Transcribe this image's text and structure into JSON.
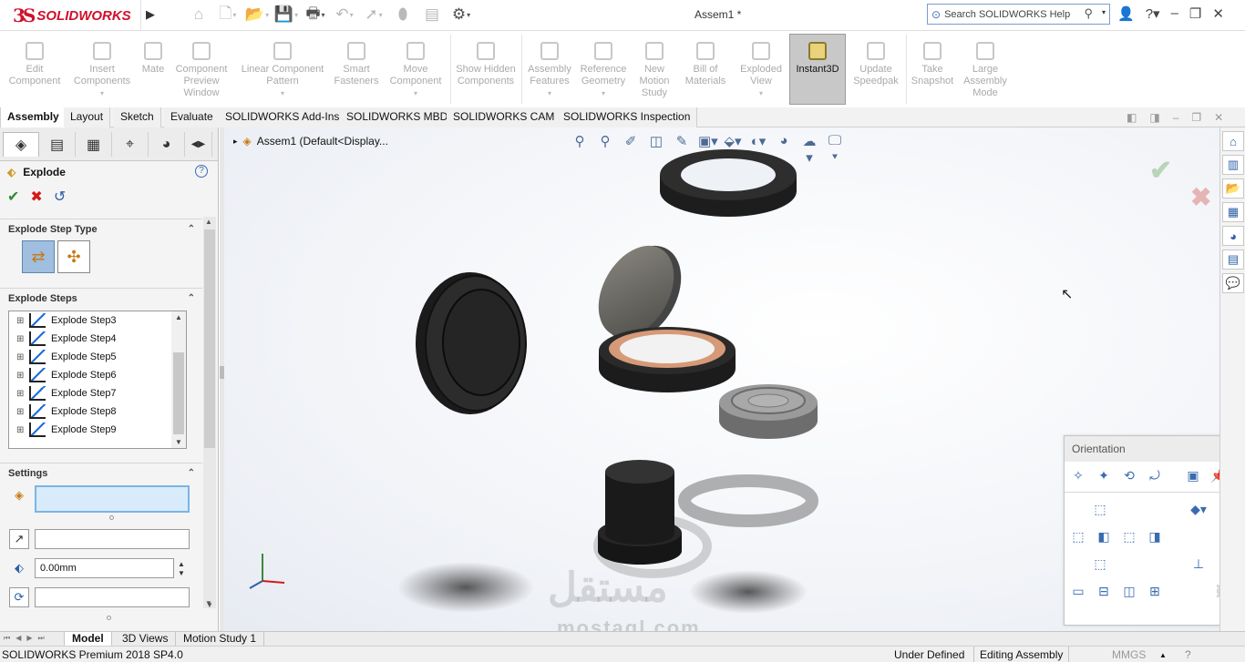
{
  "app": {
    "logo_mark": "3S",
    "logo_text": "SOLIDWORKS",
    "window_title": "Assem1 *"
  },
  "search": {
    "placeholder": "Search SOLIDWORKS Help"
  },
  "ribbon": {
    "buttons": [
      {
        "label": "Edit Component",
        "icon": "edit-component-icon"
      },
      {
        "label": "Insert Components",
        "icon": "insert-components-icon"
      },
      {
        "label": "Mate",
        "icon": "mate-icon"
      },
      {
        "label": "Component Preview Window",
        "icon": "preview-window-icon"
      },
      {
        "label": "Linear Component Pattern",
        "icon": "linear-pattern-icon"
      },
      {
        "label": "Smart Fasteners",
        "icon": "smart-fasteners-icon"
      },
      {
        "label": "Move Component",
        "icon": "move-component-icon"
      },
      {
        "label": "Show Hidden Components",
        "icon": "show-hidden-icon"
      },
      {
        "label": "Assembly Features",
        "icon": "assembly-features-icon"
      },
      {
        "label": "Reference Geometry",
        "icon": "reference-geometry-icon"
      },
      {
        "label": "New Motion Study",
        "icon": "motion-study-icon"
      },
      {
        "label": "Bill of Materials",
        "icon": "bom-icon"
      },
      {
        "label": "Exploded View",
        "icon": "exploded-view-icon"
      },
      {
        "label": "Instant3D",
        "icon": "instant3d-icon"
      },
      {
        "label": "Update Speedpak",
        "icon": "speedpak-icon"
      },
      {
        "label": "Take Snapshot",
        "icon": "snapshot-icon"
      },
      {
        "label": "Large Assembly Mode",
        "icon": "large-assembly-icon"
      }
    ]
  },
  "command_tabs": [
    "Assembly",
    "Layout",
    "Sketch",
    "Evaluate",
    "SOLIDWORKS Add-Ins",
    "SOLIDWORKS MBD",
    "SOLIDWORKS CAM",
    "SOLIDWORKS Inspection"
  ],
  "feature_manager": {
    "crumb": "Assem1  (Default<Display..."
  },
  "property_manager": {
    "title": "Explode",
    "help": "?",
    "section_step_type": "Explode Step Type",
    "section_steps": "Explode Steps",
    "section_settings": "Settings",
    "steps": [
      "Explode Step3",
      "Explode Step4",
      "Explode Step5",
      "Explode Step6",
      "Explode Step7",
      "Explode Step8",
      "Explode Step9"
    ],
    "distance_value": "0.00mm"
  },
  "orientation": {
    "title": "Orientation",
    "close": "×"
  },
  "bottom_tabs": [
    "Model",
    "3D Views",
    "Motion Study 1"
  ],
  "status": {
    "app_version": "SOLIDWORKS Premium 2018 SP4.0",
    "definition": "Under Defined",
    "mode": "Editing Assembly",
    "units": "MMGS"
  },
  "watermark": {
    "arabic": "مستقل",
    "latin": "mostaql.com"
  },
  "colors": {
    "brand_red": "#d0102c",
    "accent_blue": "#2d5fa8",
    "ok_green": "#2f8a2f"
  }
}
